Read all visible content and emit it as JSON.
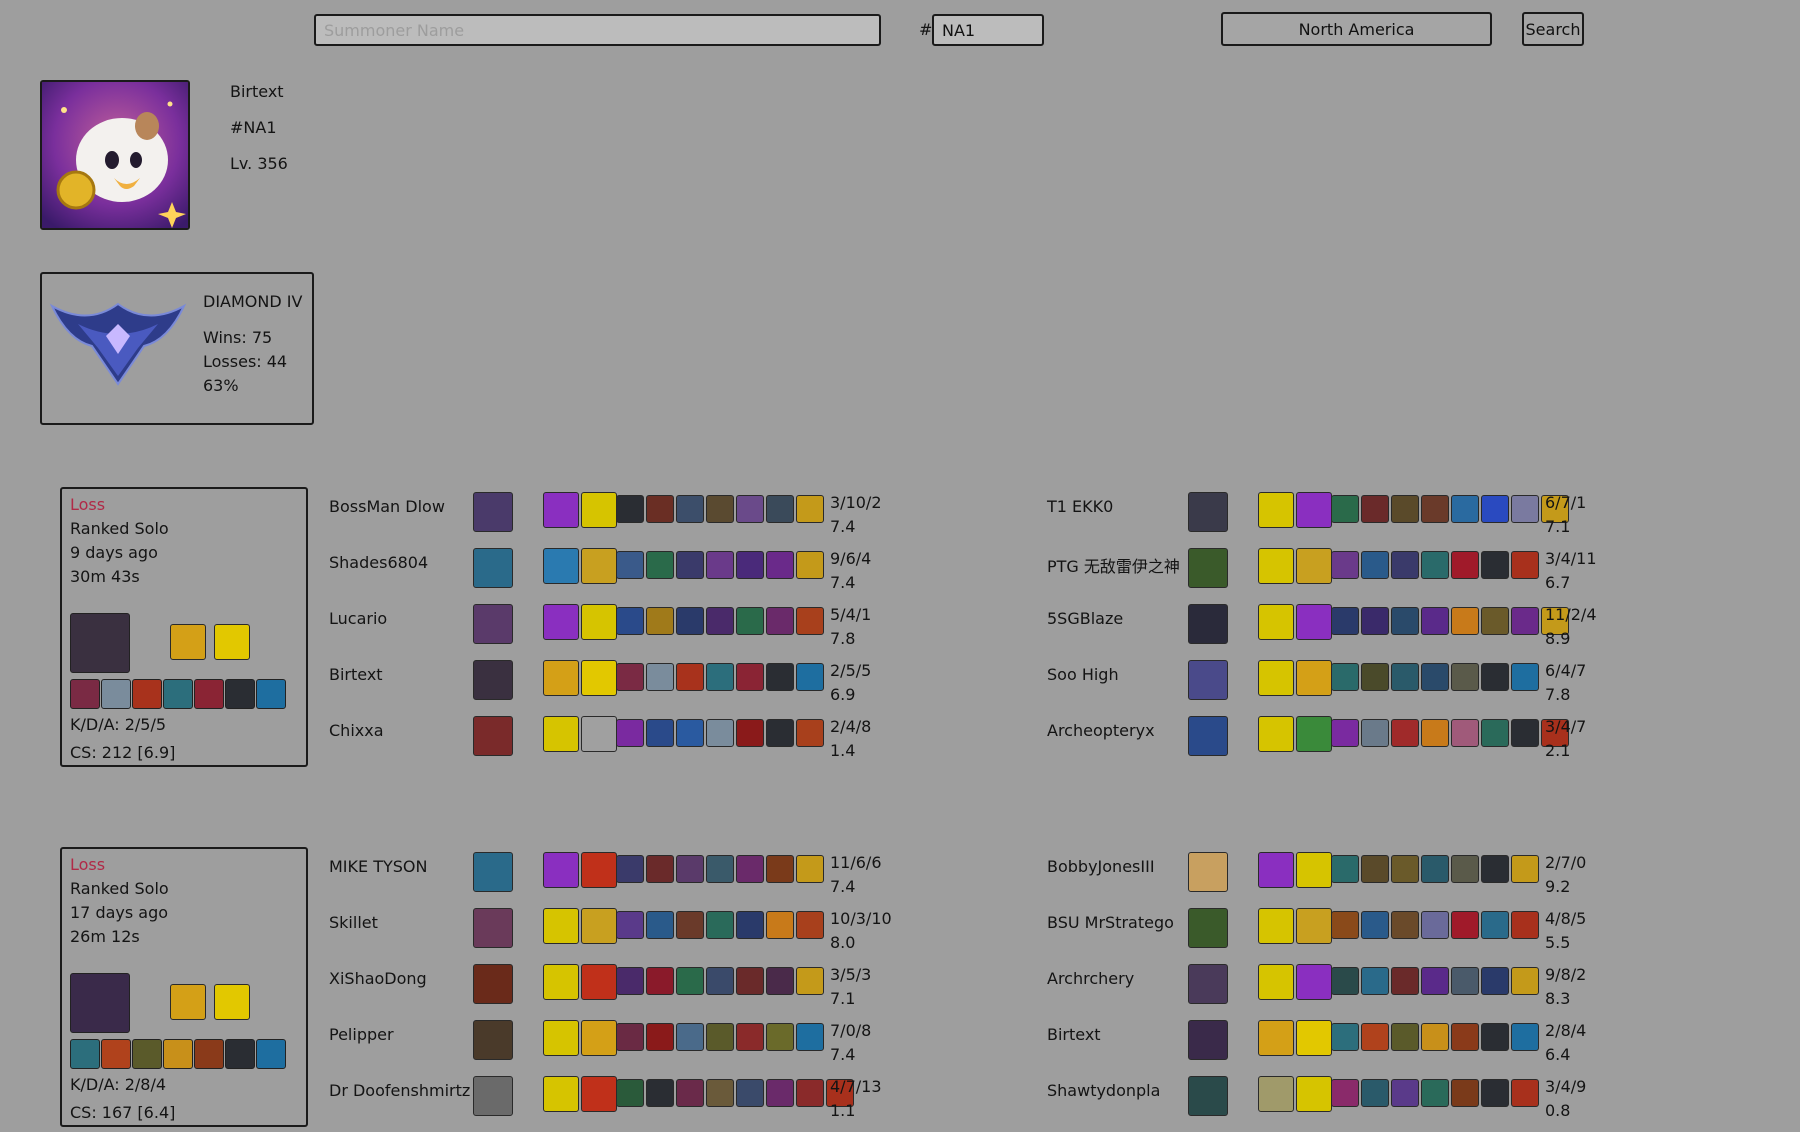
{
  "search": {
    "summoner_placeholder": "Summoner Name",
    "tag_prefix": "#",
    "tag_value": "NA1",
    "region": "North America",
    "search_label": "Search"
  },
  "profile": {
    "name": "Birtext",
    "tag": "#NA1",
    "level": "Lv. 356"
  },
  "rank": {
    "tier": "DIAMOND IV",
    "wins": "Wins: 75",
    "losses": "Losses: 44",
    "winrate": "63%"
  },
  "colors": {
    "background": "#9e9e9e",
    "loss": "#b02a47"
  },
  "matches": [
    {
      "result": "Loss",
      "queue": "Ranked Solo",
      "ago": "9 days ago",
      "duration": "30m 43s",
      "kda": "K/D/A: 2/5/5",
      "cs": "CS: 212 [6.9]",
      "champion_color": "#3a3040",
      "spells": [
        "#d4a017",
        "#e2c800"
      ],
      "items": [
        "#7a2a44",
        "#7a8c9c",
        "#a8321c",
        "#2c6e7c",
        "#8a2434",
        "",
        "#1e6ea0"
      ],
      "team_left": [
        {
          "name": "BossMan Dlow",
          "kda": "3/10/2",
          "score": "7.4",
          "champion_color": "#4a3a6a",
          "spells": [
            "#8a2fc0",
            "#d6c400"
          ],
          "items": [
            "",
            "#6a2e24",
            "#3c4e6a",
            "#5a4a30",
            "#6a4a8a",
            "#3a4a5a",
            "#c49a1a"
          ]
        },
        {
          "name": "Shades6804",
          "kda": "9/6/4",
          "score": "7.4",
          "champion_color": "#2a6a8a",
          "spells": [
            "#2a7ab0",
            "#c8a020"
          ],
          "items": [
            "#3a5a8a",
            "#2a6a4a",
            "#3a3a6a",
            "#6a3a8a",
            "#4a2a7a",
            "#6a2a8a",
            "#c49a1a"
          ]
        },
        {
          "name": "Lucario",
          "kda": "5/4/1",
          "score": "7.8",
          "champion_color": "#5a3a6a",
          "spells": [
            "#8a2fc0",
            "#d6c400"
          ],
          "items": [
            "#2a4a8a",
            "#a07a1a",
            "#2a3a6a",
            "#4a2a6a",
            "#2a6a4a",
            "#6a2a6a",
            "#a8401c"
          ]
        },
        {
          "name": "Birtext",
          "kda": "2/5/5",
          "score": "6.9",
          "champion_color": "#3a3040",
          "spells": [
            "#d4a017",
            "#e2c800"
          ],
          "items": [
            "#7a2a44",
            "#7a8c9c",
            "#a8321c",
            "#2c6e7c",
            "#8a2434",
            "",
            "#1e6ea0"
          ]
        },
        {
          "name": "Chixxa",
          "kda": "2/4/8",
          "score": "1.4",
          "champion_color": "#7a2a2a",
          "spells": [
            "#d6c400",
            "#a0a0a0"
          ],
          "items": [
            "#7a2aa0",
            "#2a4a8a",
            "#2a5aa0",
            "#7a8c9c",
            "#8a1a1a",
            "",
            "#a8401c"
          ]
        }
      ],
      "team_right": [
        {
          "name": "T1 EKK0",
          "kda": "6/7/1",
          "score": "7.1",
          "champion_color": "#3a3a4a",
          "spells": [
            "#d6c400",
            "#8a2fc0"
          ],
          "items": [
            "#2a6a4a",
            "#6a2a2a",
            "#5a4a2a",
            "#6a3a2a",
            "#2a6aa0",
            "#2a4ac0",
            "#7a7aa0",
            "#c49a1a"
          ]
        },
        {
          "name": "PTG 无敌雷伊之神",
          "kda": "3/4/11",
          "score": "6.7",
          "champion_color": "#3a5a2a",
          "spells": [
            "#d6c400",
            "#c8a020"
          ],
          "items": [
            "#6a3a8a",
            "#2a5a8a",
            "#3a3a6a",
            "#2a6a6a",
            "#a01a2a",
            "",
            "#a8301c"
          ]
        },
        {
          "name": "5SGBlaze",
          "kda": "11/2/4",
          "score": "8.9",
          "champion_color": "#2a2a3a",
          "spells": [
            "#d6c400",
            "#8a2fc0"
          ],
          "items": [
            "#2a3a6a",
            "#3a2a6a",
            "#2a4a6a",
            "#5a2a8a",
            "#c87a1a",
            "#6a5a2a",
            "#6a2a8a",
            "#c49a1a"
          ]
        },
        {
          "name": "Soo High",
          "kda": "6/4/7",
          "score": "7.8",
          "champion_color": "#4a4a8a",
          "spells": [
            "#d6c400",
            "#d4a017"
          ],
          "items": [
            "#2a6a6a",
            "#4a4a2a",
            "#2a5a6a",
            "#2a4a6a",
            "#5a5a4a",
            "",
            "#1e6ea0"
          ]
        },
        {
          "name": "Archeopteryx",
          "kda": "3/4/7",
          "score": "2.1",
          "champion_color": "#2a4a8a",
          "spells": [
            "#d6c400",
            "#3a8a3a"
          ],
          "items": [
            "#7a2aa0",
            "#6a7a8a",
            "#a02a2a",
            "#c87a1a",
            "#a05a7a",
            "#2a6a5a",
            "",
            "#a8301c"
          ]
        }
      ]
    },
    {
      "result": "Loss",
      "queue": "Ranked Solo",
      "ago": "17 days ago",
      "duration": "26m 12s",
      "kda": "K/D/A: 2/8/4",
      "cs": "CS: 167 [6.4]",
      "champion_color": "#3a2a4a",
      "spells": [
        "#d4a017",
        "#e2c800"
      ],
      "items": [
        "#2c6e7c",
        "#b0421c",
        "#5a5a2a",
        "#c8901a",
        "#8a3a1a",
        "",
        "#1e6ea0"
      ],
      "team_left": [
        {
          "name": "MIKE TYSON",
          "kda": "11/6/6",
          "score": "7.4",
          "champion_color": "#2a6a8a",
          "spells": [
            "#8a2fc0",
            "#c0301a"
          ],
          "items": [
            "#3a3a6a",
            "#6a2a2a",
            "#5a3a6a",
            "#3a5a6a",
            "#6a2a6a",
            "#7a3a1a",
            "#c49a1a"
          ]
        },
        {
          "name": "Skillet",
          "kda": "10/3/10",
          "score": "8.0",
          "champion_color": "#6a3a5a",
          "spells": [
            "#d6c400",
            "#c8a020"
          ],
          "items": [
            "#5a3a8a",
            "#2a5a8a",
            "#6a3a2a",
            "#2a6a5a",
            "#2a3a6a",
            "#c87a1a",
            "#a8401c"
          ]
        },
        {
          "name": "XiShaoDong",
          "kda": "3/5/3",
          "score": "7.1",
          "champion_color": "#6a2a1a",
          "spells": [
            "#d6c400",
            "#c0301a"
          ],
          "items": [
            "#4a2a6a",
            "#8a1a2a",
            "#2a6a4a",
            "#3a4a6a",
            "#6a2a2a",
            "#4a2a4a",
            "#c49a1a"
          ]
        },
        {
          "name": "Pelipper",
          "kda": "7/0/8",
          "score": "7.4",
          "champion_color": "#4a3a2a",
          "spells": [
            "#d6c400",
            "#d4a017"
          ],
          "items": [
            "#6a2a44",
            "#8a1a1a",
            "#4a6a8a",
            "#5a5a2a",
            "#8a2a2a",
            "#6a6a2a",
            "#1e6ea0"
          ]
        },
        {
          "name": "Dr Doofenshmirtz",
          "kda": "4/7/13",
          "score": "1.1",
          "champion_color": "#6a6a6a",
          "spells": [
            "#d6c400",
            "#c0301a"
          ],
          "items": [
            "#2a5a3a",
            "",
            "#6a2a4a",
            "#6a5a3a",
            "#3a4a6a",
            "#6a2a6a",
            "#8a2a2a",
            "#a8301c"
          ]
        }
      ],
      "team_right": [
        {
          "name": "BobbyJonesIII",
          "kda": "2/7/0",
          "score": "9.2",
          "champion_color": "#c8a060",
          "spells": [
            "#8a2fc0",
            "#d6c400"
          ],
          "items": [
            "#2a6a6a",
            "#5a4a2a",
            "#6a5a2a",
            "#2a5a6a",
            "#5a5a4a",
            "",
            "#c49a1a"
          ]
        },
        {
          "name": "BSU MrStratego",
          "kda": "4/8/5",
          "score": "5.5",
          "champion_color": "#3a5a2a",
          "spells": [
            "#d6c400",
            "#c8a020"
          ],
          "items": [
            "#8a4a1a",
            "#2a5a8a",
            "#6a4a2a",
            "#6a6a9a",
            "#a01a2a",
            "#2a6a8a",
            "#a8301c"
          ]
        },
        {
          "name": "Archrchery",
          "kda": "9/8/2",
          "score": "8.3",
          "champion_color": "#4a3a5a",
          "spells": [
            "#d6c400",
            "#8a2fc0"
          ],
          "items": [
            "#2a4a4a",
            "#2a6a8a",
            "#6a2a2a",
            "#5a2a8a",
            "#4a5a6a",
            "#2a3a6a",
            "#c49a1a"
          ]
        },
        {
          "name": "Birtext",
          "kda": "2/8/4",
          "score": "6.4",
          "champion_color": "#3a2a4a",
          "spells": [
            "#d4a017",
            "#e2c800"
          ],
          "items": [
            "#2c6e7c",
            "#b0421c",
            "#5a5a2a",
            "#c8901a",
            "#8a3a1a",
            "",
            "#1e6ea0"
          ]
        },
        {
          "name": "Shawtydonpla",
          "kda": "3/4/9",
          "score": "0.8",
          "champion_color": "#2a4a4a",
          "spells": [
            "#a09a6a",
            "#d6c400"
          ],
          "items": [
            "#8a2a6a",
            "#2a5a6a",
            "#5a3a8a",
            "#2a6a5a",
            "#7a3a1a",
            "",
            "#a8301c"
          ]
        }
      ]
    }
  ]
}
